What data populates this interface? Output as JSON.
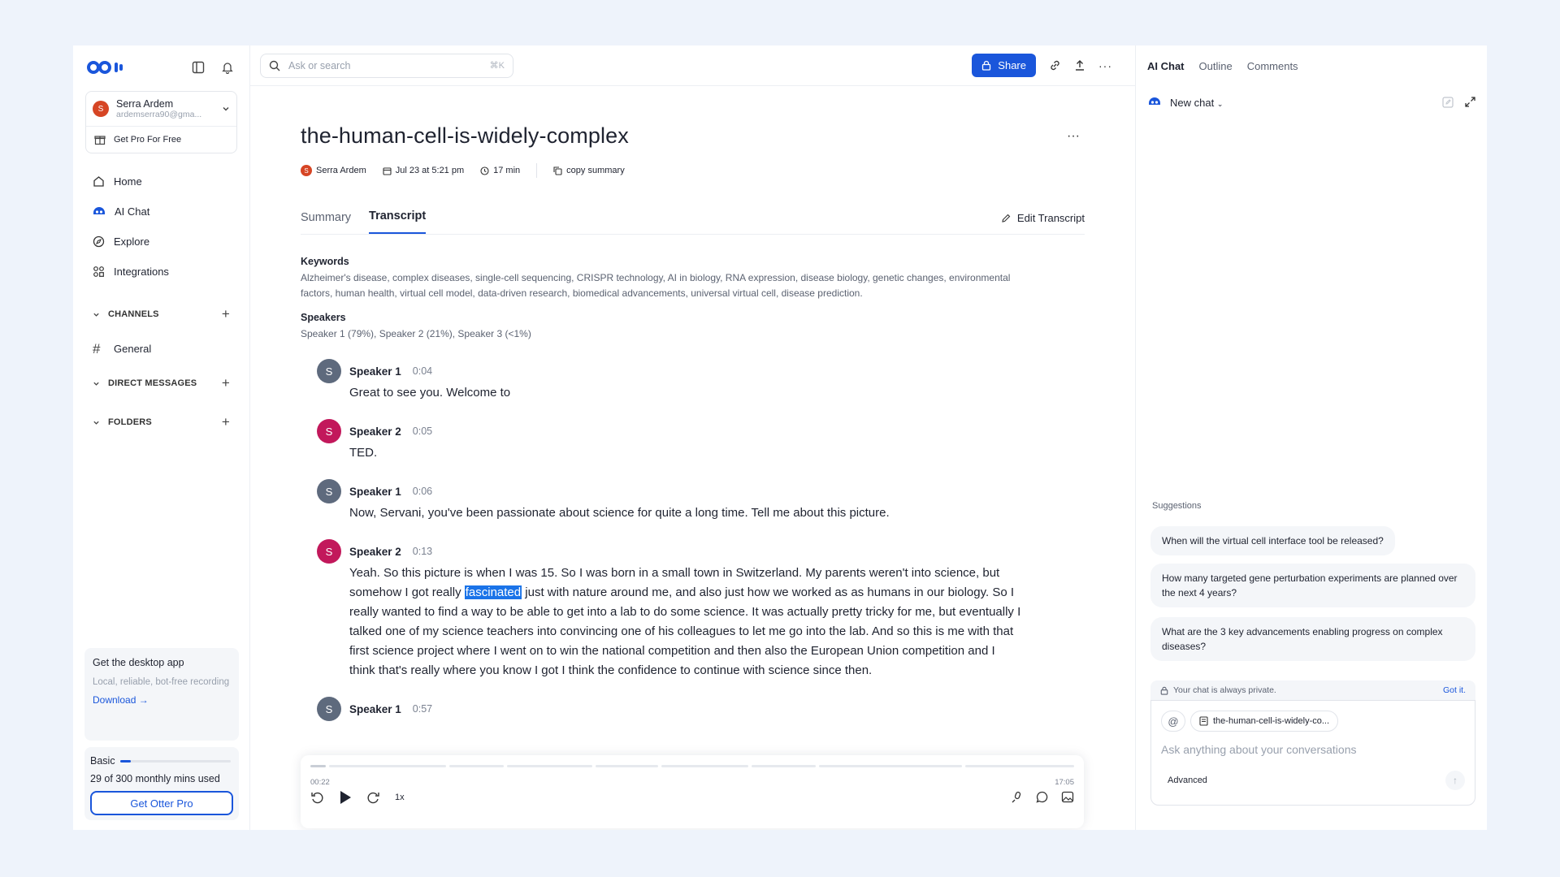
{
  "colors": {
    "brand": "#1a56db",
    "avatar_orange": "#d64524",
    "speaker1": "#5e6a7d",
    "speaker2": "#c2185b"
  },
  "sidebar": {
    "account": {
      "avatar": "S",
      "name": "Serra Ardem",
      "email": "ardemserra90@gma..."
    },
    "pro_link": "Get Pro For Free",
    "nav": [
      {
        "label": "Home",
        "icon": "home-icon"
      },
      {
        "label": "AI Chat",
        "icon": "ai-chat-icon"
      },
      {
        "label": "Explore",
        "icon": "compass-icon"
      },
      {
        "label": "Integrations",
        "icon": "integrations-icon"
      }
    ],
    "sections": {
      "channels": "CHANNELS",
      "channel_general": "General",
      "dms": "DIRECT MESSAGES",
      "folders": "FOLDERS"
    },
    "desktop": {
      "title": "Get the desktop app",
      "subtitle": "Local, reliable, bot-free recording",
      "link": "Download"
    },
    "plan": {
      "name": "Basic",
      "usage": "29 of 300 monthly mins used",
      "progress": 0.097,
      "button": "Get Otter Pro"
    }
  },
  "topbar": {
    "search_placeholder": "Ask or search",
    "shortcut": "⌘K",
    "share": "Share"
  },
  "document": {
    "title": "the-human-cell-is-widely-complex",
    "meta": {
      "owner": "Serra Ardem",
      "owner_initial": "S",
      "date": "Jul 23 at 5:21 pm",
      "duration": "17 min",
      "copy": "copy summary"
    },
    "tabs": [
      "Summary",
      "Transcript"
    ],
    "edit": "Edit Transcript",
    "keywords_label": "Keywords",
    "keywords": "Alzheimer's disease, complex diseases, single-cell sequencing, CRISPR technology, AI in biology, RNA expression, disease biology, genetic changes, environmental factors, human health, virtual cell model, data-driven research, biomedical advancements, universal virtual cell, disease prediction.",
    "speakers_label": "Speakers",
    "speakers": "Speaker 1 (79%), Speaker 2 (21%), Speaker 3 (<1%)"
  },
  "transcript": [
    {
      "initial": "S",
      "speaker": "Speaker 1",
      "time": "0:04",
      "text": "Great to see you. Welcome to"
    },
    {
      "initial": "S",
      "speaker": "Speaker 2",
      "time": "0:05",
      "text": "TED."
    },
    {
      "initial": "S",
      "speaker": "Speaker 1",
      "time": "0:06",
      "text": "Now, Servani, you've been passionate about science for quite a long time. Tell me about this picture."
    },
    {
      "initial": "S",
      "speaker": "Speaker 2",
      "time": "0:13",
      "text_before": "Yeah. So this picture is when I was 15. So I was born in a small town in Switzerland. My parents weren't into science, but somehow I got really ",
      "highlight": "fascinated",
      "text_after": " just with nature around me, and also just how we worked as as humans in our biology. So I really wanted to find a way to be able to get into a lab to do some science. It was actually pretty tricky for me, but eventually I talked one of my science teachers into convincing one of his colleagues to let me go into the lab. And so this is me with that first science project where I went on to win the national competition and then also the European Union competition and I think that's really where you know I got I think the confidence to continue with science since then."
    },
    {
      "initial": "S",
      "speaker": "Speaker 1",
      "time": "0:57",
      "text": ""
    }
  ],
  "player": {
    "current": "00:22",
    "total": "17:05",
    "speed": "1x",
    "progress": 0.022
  },
  "right": {
    "tabs": [
      "AI Chat",
      "Outline",
      "Comments"
    ],
    "new_chat": "New chat",
    "suggestions_label": "Suggestions",
    "suggestions": [
      "When will the virtual cell interface tool be released?",
      "How many targeted gene perturbation experiments are planned over the next 4 years?",
      "What are the 3 key advancements enabling progress on complex diseases?"
    ],
    "private": "Your chat is always private.",
    "got_it": "Got it.",
    "at": "@",
    "file_chip": "the-human-cell-is-widely-co...",
    "input_placeholder": "Ask anything about your conversations",
    "advanced": "Advanced"
  }
}
